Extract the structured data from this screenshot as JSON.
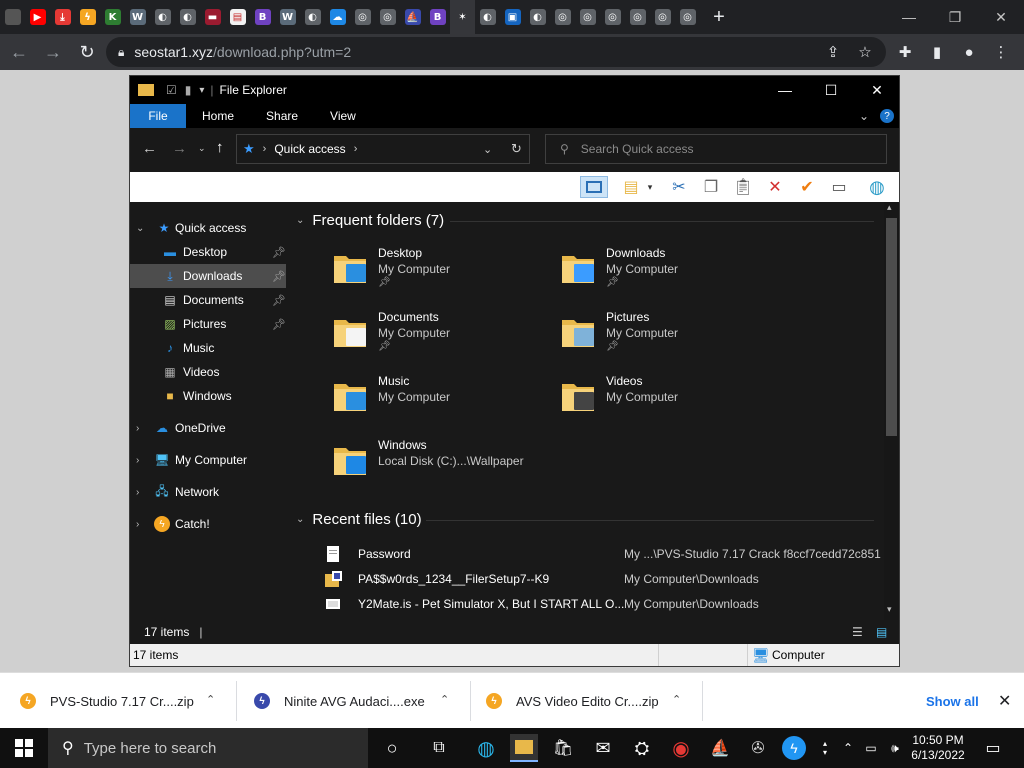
{
  "browser": {
    "tabs_favicons": [
      {
        "icon": "gray-page-icon",
        "color": "#555555",
        "glyph": ""
      },
      {
        "icon": "youtube-icon",
        "color": "#ff0000",
        "glyph": "▶"
      },
      {
        "icon": "download-icon",
        "color": "#e53935",
        "glyph": "⤓"
      },
      {
        "icon": "lightning-icon",
        "color": "#f5a623",
        "glyph": "ϟ"
      },
      {
        "icon": "k-icon",
        "color": "#2e7d32",
        "glyph": "K"
      },
      {
        "icon": "wordpress-icon",
        "color": "#5b6b7a",
        "glyph": "W"
      },
      {
        "icon": "globe-icon",
        "color": "#5f6368",
        "glyph": "◐"
      },
      {
        "icon": "globe-icon",
        "color": "#5f6368",
        "glyph": "◐"
      },
      {
        "icon": "red-banner-icon",
        "color": "#9b1b30",
        "glyph": "▬"
      },
      {
        "icon": "document-icon",
        "color": "#f2f2f2",
        "glyph": "▤"
      },
      {
        "icon": "bootstrap-icon",
        "color": "#6f42c1",
        "glyph": "B"
      },
      {
        "icon": "wordpress-icon",
        "color": "#5b6b7a",
        "glyph": "W"
      },
      {
        "icon": "globe-icon",
        "color": "#5f6368",
        "glyph": "◐"
      },
      {
        "icon": "cloud-icon",
        "color": "#1e88e5",
        "glyph": "☁"
      },
      {
        "icon": "chrome-icon",
        "color": "#5f6368",
        "glyph": "◎"
      },
      {
        "icon": "chrome-icon",
        "color": "#5f6368",
        "glyph": "◎"
      },
      {
        "icon": "sail-icon",
        "color": "#3949ab",
        "glyph": "⛵"
      },
      {
        "icon": "bootstrap-icon",
        "color": "#6f42c1",
        "glyph": "B"
      },
      {
        "icon": "sparkle-icon",
        "color": "#35363a",
        "glyph": "✶"
      },
      {
        "icon": "globe-icon",
        "color": "#5f6368",
        "glyph": "◐"
      },
      {
        "icon": "toolbox-icon",
        "color": "#1565c0",
        "glyph": "▣"
      },
      {
        "icon": "globe-icon",
        "color": "#5f6368",
        "glyph": "◐"
      },
      {
        "icon": "chrome-icon",
        "color": "#5f6368",
        "glyph": "◎"
      },
      {
        "icon": "chrome-icon",
        "color": "#5f6368",
        "glyph": "◎"
      },
      {
        "icon": "chrome-icon",
        "color": "#5f6368",
        "glyph": "◎"
      },
      {
        "icon": "chrome-icon",
        "color": "#5f6368",
        "glyph": "◎"
      },
      {
        "icon": "chrome-icon",
        "color": "#5f6368",
        "glyph": "◎"
      },
      {
        "icon": "chrome-icon",
        "color": "#5f6368",
        "glyph": "◎"
      }
    ],
    "active_tab_index": 18,
    "url_host": "seostar1.xyz",
    "url_path": "/download.php?utm=2"
  },
  "explorer": {
    "title": "File Explorer",
    "ribbon_tabs": [
      "File",
      "Home",
      "Share",
      "View"
    ],
    "breadcrumb": "Quick access",
    "search_placeholder": "Search Quick access",
    "nav": {
      "quick_access": "Quick access",
      "items": [
        {
          "label": "Desktop",
          "pinned": true
        },
        {
          "label": "Downloads",
          "pinned": true,
          "selected": true
        },
        {
          "label": "Documents",
          "pinned": true
        },
        {
          "label": "Pictures",
          "pinned": true
        },
        {
          "label": "Music",
          "pinned": false
        },
        {
          "label": "Videos",
          "pinned": false
        },
        {
          "label": "Windows",
          "pinned": false
        }
      ],
      "roots": [
        "OneDrive",
        "My Computer",
        "Network",
        "Catch!"
      ]
    },
    "frequent_header": "Frequent folders (7)",
    "folders": [
      {
        "name": "Desktop",
        "sub": "My Computer",
        "pinned": true
      },
      {
        "name": "Downloads",
        "sub": "My Computer",
        "pinned": true
      },
      {
        "name": "Documents",
        "sub": "My Computer",
        "pinned": true
      },
      {
        "name": "Pictures",
        "sub": "My Computer",
        "pinned": true
      },
      {
        "name": "Music",
        "sub": "My Computer",
        "pinned": false
      },
      {
        "name": "Videos",
        "sub": "My Computer",
        "pinned": false
      },
      {
        "name": "Windows",
        "sub": "Local Disk (C:)...\\Wallpaper",
        "pinned": false
      }
    ],
    "recent_header": "Recent files (10)",
    "recent": [
      {
        "name": "Password",
        "path": "My ...\\PVS-Studio 7.17 Crack f8ccf7cedd72c851"
      },
      {
        "name": "PA$$w0rds_1234__FilerSetup7--K9",
        "path": "My Computer\\Downloads"
      },
      {
        "name": "Y2Mate.is - Pet Simulator X, But I START ALL O...",
        "path": "My Computer\\Downloads"
      }
    ],
    "status_items": "17 items",
    "bottom_items": "17 items",
    "bottom_location": "Computer"
  },
  "downloads": [
    {
      "name": "PVS-Studio 7.17 Cr....zip",
      "color": "#f5a623"
    },
    {
      "name": "Ninite AVG Audaci....exe",
      "color": "#3949ab"
    },
    {
      "name": "AVS Video Edito Cr....zip",
      "color": "#f5a623"
    }
  ],
  "show_all": "Show all",
  "taskbar": {
    "search_placeholder": "Type here to search",
    "time": "10:50 PM",
    "date": "6/13/2022"
  }
}
